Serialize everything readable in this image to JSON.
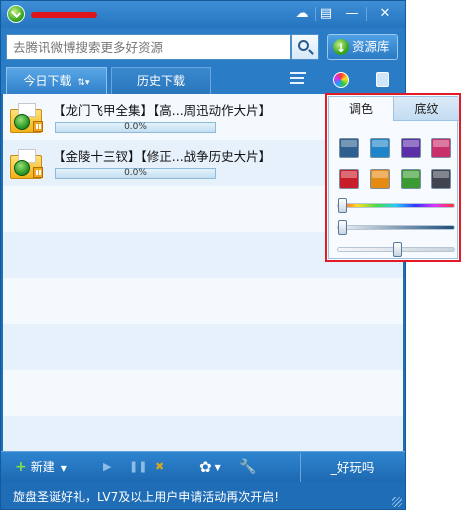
{
  "window": {
    "user_name_redacted": "user name (redacted)"
  },
  "titlebar": {
    "buttons": [
      {
        "icon": "chat-bubble-icon",
        "glyph": "☁"
      },
      {
        "icon": "menu-icon",
        "glyph": "▤"
      },
      {
        "icon": "minimize-icon",
        "glyph": "—"
      },
      {
        "icon": "close-icon",
        "glyph": "✕"
      }
    ]
  },
  "search": {
    "placeholder": "去腾讯微博搜索更多好资源",
    "resource_label": "资源库"
  },
  "tabs": {
    "today": "今日下载",
    "history": "历史下载"
  },
  "tasks": [
    {
      "name": "【龙门飞甲全集】【高...周迅动作大片】",
      "progress": "0.0%",
      "progress_value": 0.0
    },
    {
      "name": "【金陵十三钗】【修正...战争历史大片】",
      "progress": "0.0%",
      "progress_value": 0.0
    }
  ],
  "toolbar": {
    "new_label": "新建",
    "play_glyph": "▶",
    "pause_glyph": "❚❚",
    "delete_glyph": "✖",
    "gear_glyph": "✿",
    "wrench_glyph": "🔧",
    "fun_label": "_好玩吗"
  },
  "status": {
    "text": "旋盘圣诞好礼，LV7及以上用户申请活动再次开启!"
  },
  "skin_panel": {
    "tab_color": "调色",
    "tab_texture": "底纹",
    "swatches": [
      "#2d5f8f",
      "#1f84c8",
      "#5b2fa6",
      "#c8306c",
      "#c81e2a",
      "#e58a12",
      "#3c9a34",
      "#3f4450"
    ],
    "hue_level": 0.0,
    "saturation_level": 0.0,
    "lightness_level": 0.5
  },
  "colors": {
    "accent": "#2a7cc6",
    "frame_highlight": "#e01c2a"
  }
}
